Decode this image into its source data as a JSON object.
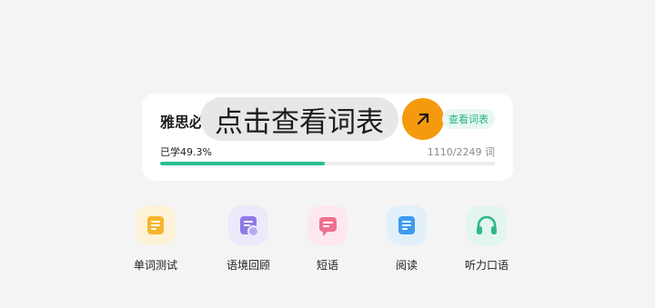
{
  "card": {
    "book_title": "雅思必",
    "overlay_text": "点击查看词表",
    "view_button": "查看词表",
    "learned_text": "已学49.3%",
    "progress": 0.493,
    "count_text": "1110/2249 词"
  },
  "features": [
    {
      "label": "单词测试",
      "icon": "document-icon",
      "bg": "#fdf1d8",
      "fg": "#f7b52c"
    },
    {
      "label": "语境回顾",
      "icon": "document-review-icon",
      "bg": "#ece9fb",
      "fg": "#8f7ae8"
    },
    {
      "label": "短语",
      "icon": "chat-bubble-icon",
      "bg": "#fce8ee",
      "fg": "#f0708f"
    },
    {
      "label": "阅读",
      "icon": "reading-icon",
      "bg": "#e2f0fc",
      "fg": "#3e9af0"
    },
    {
      "label": "听力口语",
      "icon": "headphones-icon",
      "bg": "#e2f5ee",
      "fg": "#2fb886"
    }
  ],
  "colors": {
    "accent": "#27bf92",
    "arrow_button": "#f59a0d"
  }
}
